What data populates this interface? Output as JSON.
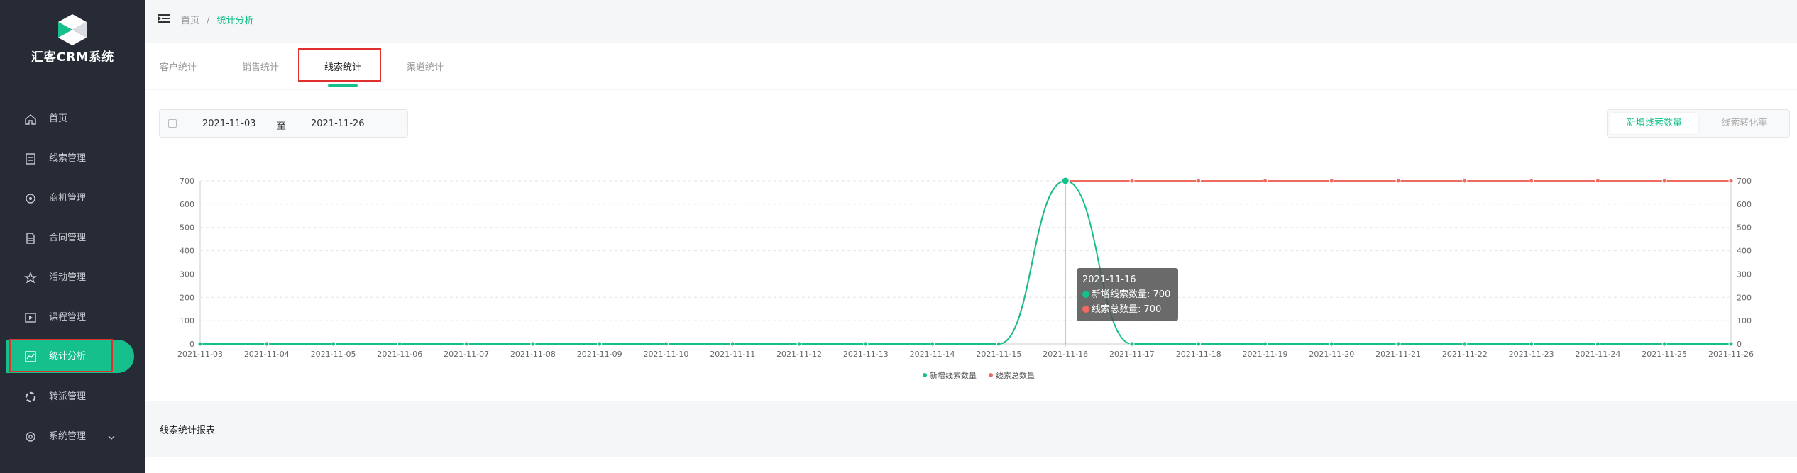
{
  "app": {
    "name": "汇客CRM系统"
  },
  "sidebar": {
    "items": [
      {
        "label": "首页",
        "icon": "home-icon"
      },
      {
        "label": "线索管理",
        "icon": "clue-icon"
      },
      {
        "label": "商机管理",
        "icon": "business-icon"
      },
      {
        "label": "合同管理",
        "icon": "contract-icon"
      },
      {
        "label": "活动管理",
        "icon": "activity-icon"
      },
      {
        "label": "课程管理",
        "icon": "course-icon"
      },
      {
        "label": "统计分析",
        "icon": "chart-icon",
        "active": true
      },
      {
        "label": "转派管理",
        "icon": "transfer-icon"
      },
      {
        "label": "系统管理",
        "icon": "settings-icon"
      }
    ]
  },
  "breadcrumb": {
    "home": "首页",
    "separator": "/",
    "current": "统计分析"
  },
  "tabs": [
    {
      "label": "客户统计"
    },
    {
      "label": "销售统计"
    },
    {
      "label": "线索统计",
      "selected": true
    },
    {
      "label": "渠道统计"
    }
  ],
  "daterange": {
    "start": "2021-11-03",
    "to": "至",
    "end": "2021-11-26"
  },
  "toggle": {
    "option1": "新增线索数量",
    "option2": "线索转化率"
  },
  "tooltip": {
    "date": "2021-11-16",
    "row1": "新增线索数量: 700",
    "row2": "线索总数量: 700"
  },
  "report": {
    "title": "线索统计报表"
  },
  "colors": {
    "accent": "#16c08c",
    "new_series": "#16c08c",
    "total_series": "#ef6b5f",
    "sidebar_bg": "#262b36"
  },
  "chart_data": {
    "type": "line",
    "x": [
      "2021-11-03",
      "2021-11-04",
      "2021-11-05",
      "2021-11-06",
      "2021-11-07",
      "2021-11-08",
      "2021-11-09",
      "2021-11-10",
      "2021-11-11",
      "2021-11-12",
      "2021-11-13",
      "2021-11-14",
      "2021-11-15",
      "2021-11-16",
      "2021-11-17",
      "2021-11-18",
      "2021-11-19",
      "2021-11-20",
      "2021-11-21",
      "2021-11-22",
      "2021-11-23",
      "2021-11-24",
      "2021-11-25",
      "2021-11-26"
    ],
    "series": [
      {
        "name": "新增线索数量",
        "color": "#16c08c",
        "values": [
          0,
          0,
          0,
          0,
          0,
          0,
          0,
          0,
          0,
          0,
          0,
          0,
          0,
          700,
          0,
          0,
          0,
          0,
          0,
          0,
          0,
          0,
          0,
          0
        ]
      },
      {
        "name": "线索总数量",
        "color": "#ef6b5f",
        "values": [
          0,
          0,
          0,
          0,
          0,
          0,
          0,
          0,
          0,
          0,
          0,
          0,
          0,
          700,
          700,
          700,
          700,
          700,
          700,
          700,
          700,
          700,
          700,
          700
        ]
      }
    ],
    "yticks": [
      0,
      100,
      200,
      300,
      400,
      500,
      600,
      700
    ],
    "ylim": [
      0,
      700
    ],
    "y_right_axis": true,
    "smooth": true,
    "grid": "horizontal-dashed",
    "legend": "bottom-center",
    "highlight_x": "2021-11-16"
  }
}
